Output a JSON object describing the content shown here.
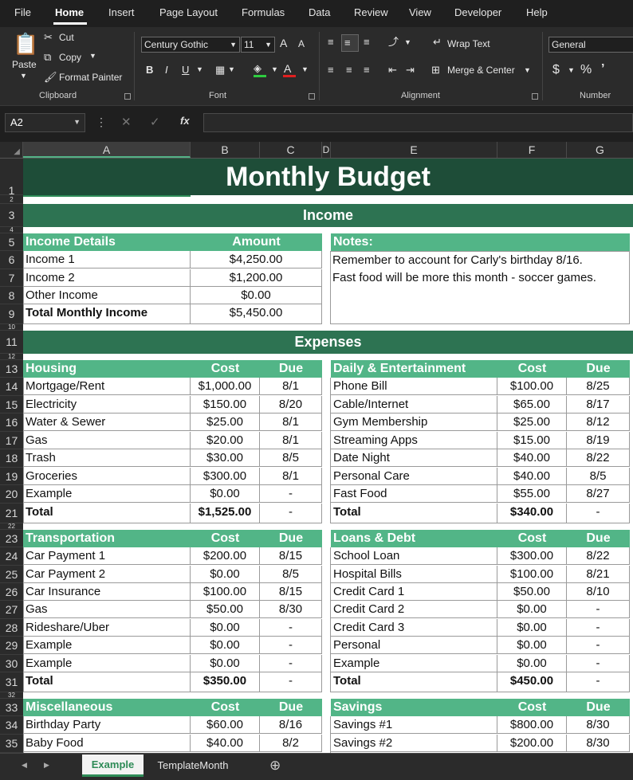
{
  "menu": [
    "File",
    "Home",
    "Insert",
    "Page Layout",
    "Formulas",
    "Data",
    "Review",
    "View",
    "Developer",
    "Help"
  ],
  "clipboard": {
    "paste": "Paste",
    "cut": "Cut",
    "copy": "Copy",
    "format_painter": "Format Painter",
    "label": "Clipboard"
  },
  "font": {
    "name": "Century Gothic",
    "size": "11",
    "label": "Font",
    "bold": "B",
    "italic": "I",
    "underline": "U",
    "grow": "A",
    "shrink": "A"
  },
  "alignment": {
    "wrap": "Wrap Text",
    "merge": "Merge & Center",
    "label": "Alignment"
  },
  "number": {
    "format": "General",
    "currency": "$",
    "percent": "%",
    "label": "Number"
  },
  "formula_bar": {
    "name_box": "A2",
    "fx": "fx",
    "value": ""
  },
  "columns": [
    "A",
    "B",
    "C",
    "D",
    "E",
    "F",
    "G"
  ],
  "rows": [
    "1",
    "2",
    "3",
    "4",
    "5",
    "6",
    "7",
    "8",
    "9",
    "10",
    "11",
    "12",
    "13",
    "14",
    "15",
    "16",
    "17",
    "18",
    "19",
    "20",
    "21",
    "22",
    "23",
    "24",
    "25",
    "26",
    "27",
    "28",
    "29",
    "30",
    "31",
    "32",
    "33",
    "34",
    "35"
  ],
  "sheet": {
    "title": "Monthly Budget",
    "income_band": "Income",
    "expenses_band": "Expenses",
    "income": {
      "header": [
        "Income Details",
        "Amount"
      ],
      "rows": [
        [
          "Income 1",
          "$4,250.00"
        ],
        [
          "Income 2",
          "$1,200.00"
        ],
        [
          "Other Income",
          "$0.00"
        ]
      ],
      "total": [
        "Total Monthly Income",
        "$5,450.00"
      ]
    },
    "notes": {
      "header": "Notes:",
      "lines": [
        "Remember to account for Carly's birthday 8/16.",
        "Fast food will be more this month - soccer games."
      ]
    },
    "housing": {
      "header": [
        "Housing",
        "Cost",
        "Due"
      ],
      "rows": [
        [
          "Mortgage/Rent",
          "$1,000.00",
          "8/1"
        ],
        [
          "Electricity",
          "$150.00",
          "8/20"
        ],
        [
          "Water & Sewer",
          "$25.00",
          "8/1"
        ],
        [
          "Gas",
          "$20.00",
          "8/1"
        ],
        [
          "Trash",
          "$30.00",
          "8/5"
        ],
        [
          "Groceries",
          "$300.00",
          "8/1"
        ],
        [
          "Example",
          "$0.00",
          "-"
        ]
      ],
      "total": [
        "Total",
        "$1,525.00",
        "-"
      ]
    },
    "daily": {
      "header": [
        "Daily & Entertainment",
        "Cost",
        "Due"
      ],
      "rows": [
        [
          "Phone Bill",
          "$100.00",
          "8/25"
        ],
        [
          "Cable/Internet",
          "$65.00",
          "8/17"
        ],
        [
          "Gym Membership",
          "$25.00",
          "8/12"
        ],
        [
          "Streaming Apps",
          "$15.00",
          "8/19"
        ],
        [
          "Date Night",
          "$40.00",
          "8/22"
        ],
        [
          "Personal Care",
          "$40.00",
          "8/5"
        ],
        [
          "Fast Food",
          "$55.00",
          "8/27"
        ]
      ],
      "total": [
        "Total",
        "$340.00",
        "-"
      ]
    },
    "transportation": {
      "header": [
        "Transportation",
        "Cost",
        "Due"
      ],
      "rows": [
        [
          "Car Payment 1",
          "$200.00",
          "8/15"
        ],
        [
          "Car Payment 2",
          "$0.00",
          "8/5"
        ],
        [
          "Car Insurance",
          "$100.00",
          "8/15"
        ],
        [
          "Gas",
          "$50.00",
          "8/30"
        ],
        [
          "Rideshare/Uber",
          "$0.00",
          "-"
        ],
        [
          "Example",
          "$0.00",
          "-"
        ],
        [
          "Example",
          "$0.00",
          "-"
        ]
      ],
      "total": [
        "Total",
        "$350.00",
        "-"
      ]
    },
    "loans": {
      "header": [
        "Loans & Debt",
        "Cost",
        "Due"
      ],
      "rows": [
        [
          "School Loan",
          "$300.00",
          "8/22"
        ],
        [
          "Hospital Bills",
          "$100.00",
          "8/21"
        ],
        [
          "Credit Card 1",
          "$50.00",
          "8/10"
        ],
        [
          "Credit Card 2",
          "$0.00",
          "-"
        ],
        [
          "Credit Card 3",
          "$0.00",
          "-"
        ],
        [
          "Personal",
          "$0.00",
          "-"
        ],
        [
          "Example",
          "$0.00",
          "-"
        ]
      ],
      "total": [
        "Total",
        "$450.00",
        "-"
      ]
    },
    "misc": {
      "header": [
        "Miscellaneous",
        "Cost",
        "Due"
      ],
      "rows": [
        [
          "Birthday Party",
          "$60.00",
          "8/16"
        ],
        [
          "Baby Food",
          "$40.00",
          "8/2"
        ]
      ]
    },
    "savings": {
      "header": [
        "Savings",
        "Cost",
        "Due"
      ],
      "rows": [
        [
          "Savings #1",
          "$800.00",
          "8/30"
        ],
        [
          "Savings #2",
          "$200.00",
          "8/30"
        ]
      ]
    }
  },
  "tabs": [
    "Example",
    "TemplateMonth"
  ],
  "colors": {
    "dark_green": "#1e4d38",
    "mid_green": "#2d7352",
    "light_green": "#52b587",
    "tab_active": "#2e8b57"
  }
}
